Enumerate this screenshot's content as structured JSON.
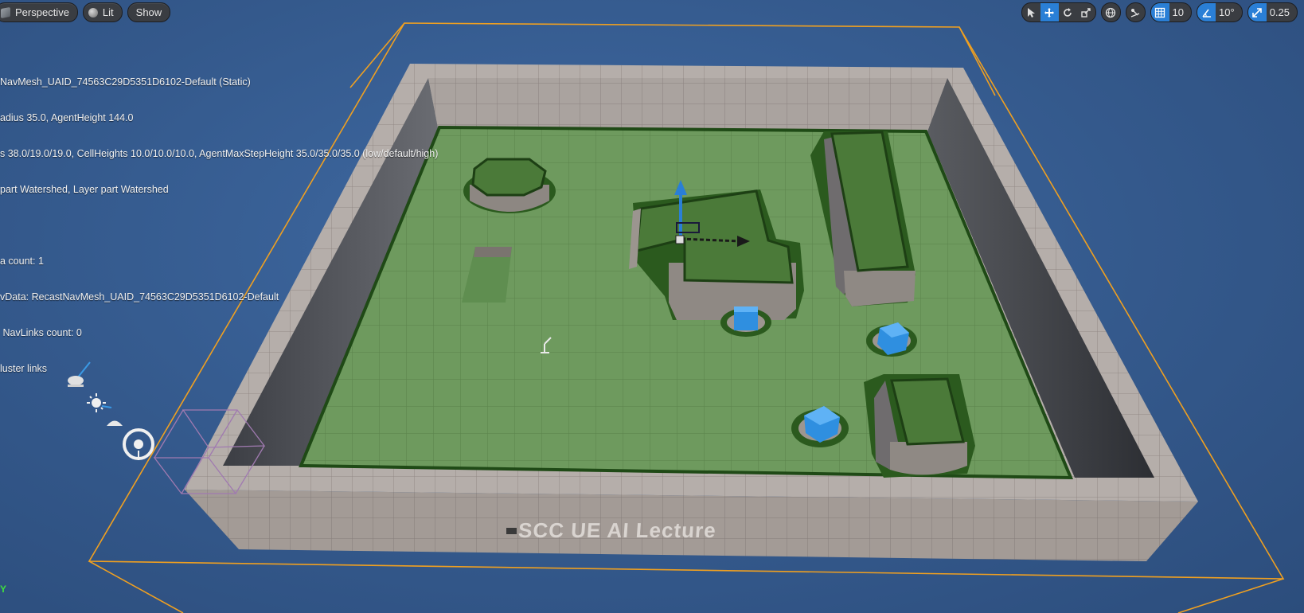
{
  "toolbar": {
    "view_mode": "Perspective",
    "lighting_mode": "Lit",
    "show_label": "Show",
    "grid_snap_value": "10",
    "rotation_snap_value": "10°",
    "scale_snap_value": "0.25"
  },
  "stats": {
    "lines": [
      "NavMesh_UAID_74563C29D5351D6102-Default (Static)",
      "adius 35.0, AgentHeight 144.0",
      "s 38.0/19.0/19.0, CellHeights 10.0/10.0/10.0, AgentMaxStepHeight 35.0/35.0/35.0 (low/default/high)",
      "part Watershed, Layer part Watershed",
      "",
      "a count: 1",
      "vData: RecastNavMesh_UAID_74563C29D5351D6102-Default",
      " NavLinks count: 0",
      "luster links"
    ]
  },
  "level": {
    "wall_text": "SCC UE AI Lecture"
  },
  "axis_label": "Y",
  "colors": {
    "background": "#34598c",
    "navmesh": "#6e9a5e",
    "wall": "#a9a29d",
    "bounds": "#f0a020",
    "accent": "#2a7fd6",
    "cube": "#2f8fe0"
  }
}
